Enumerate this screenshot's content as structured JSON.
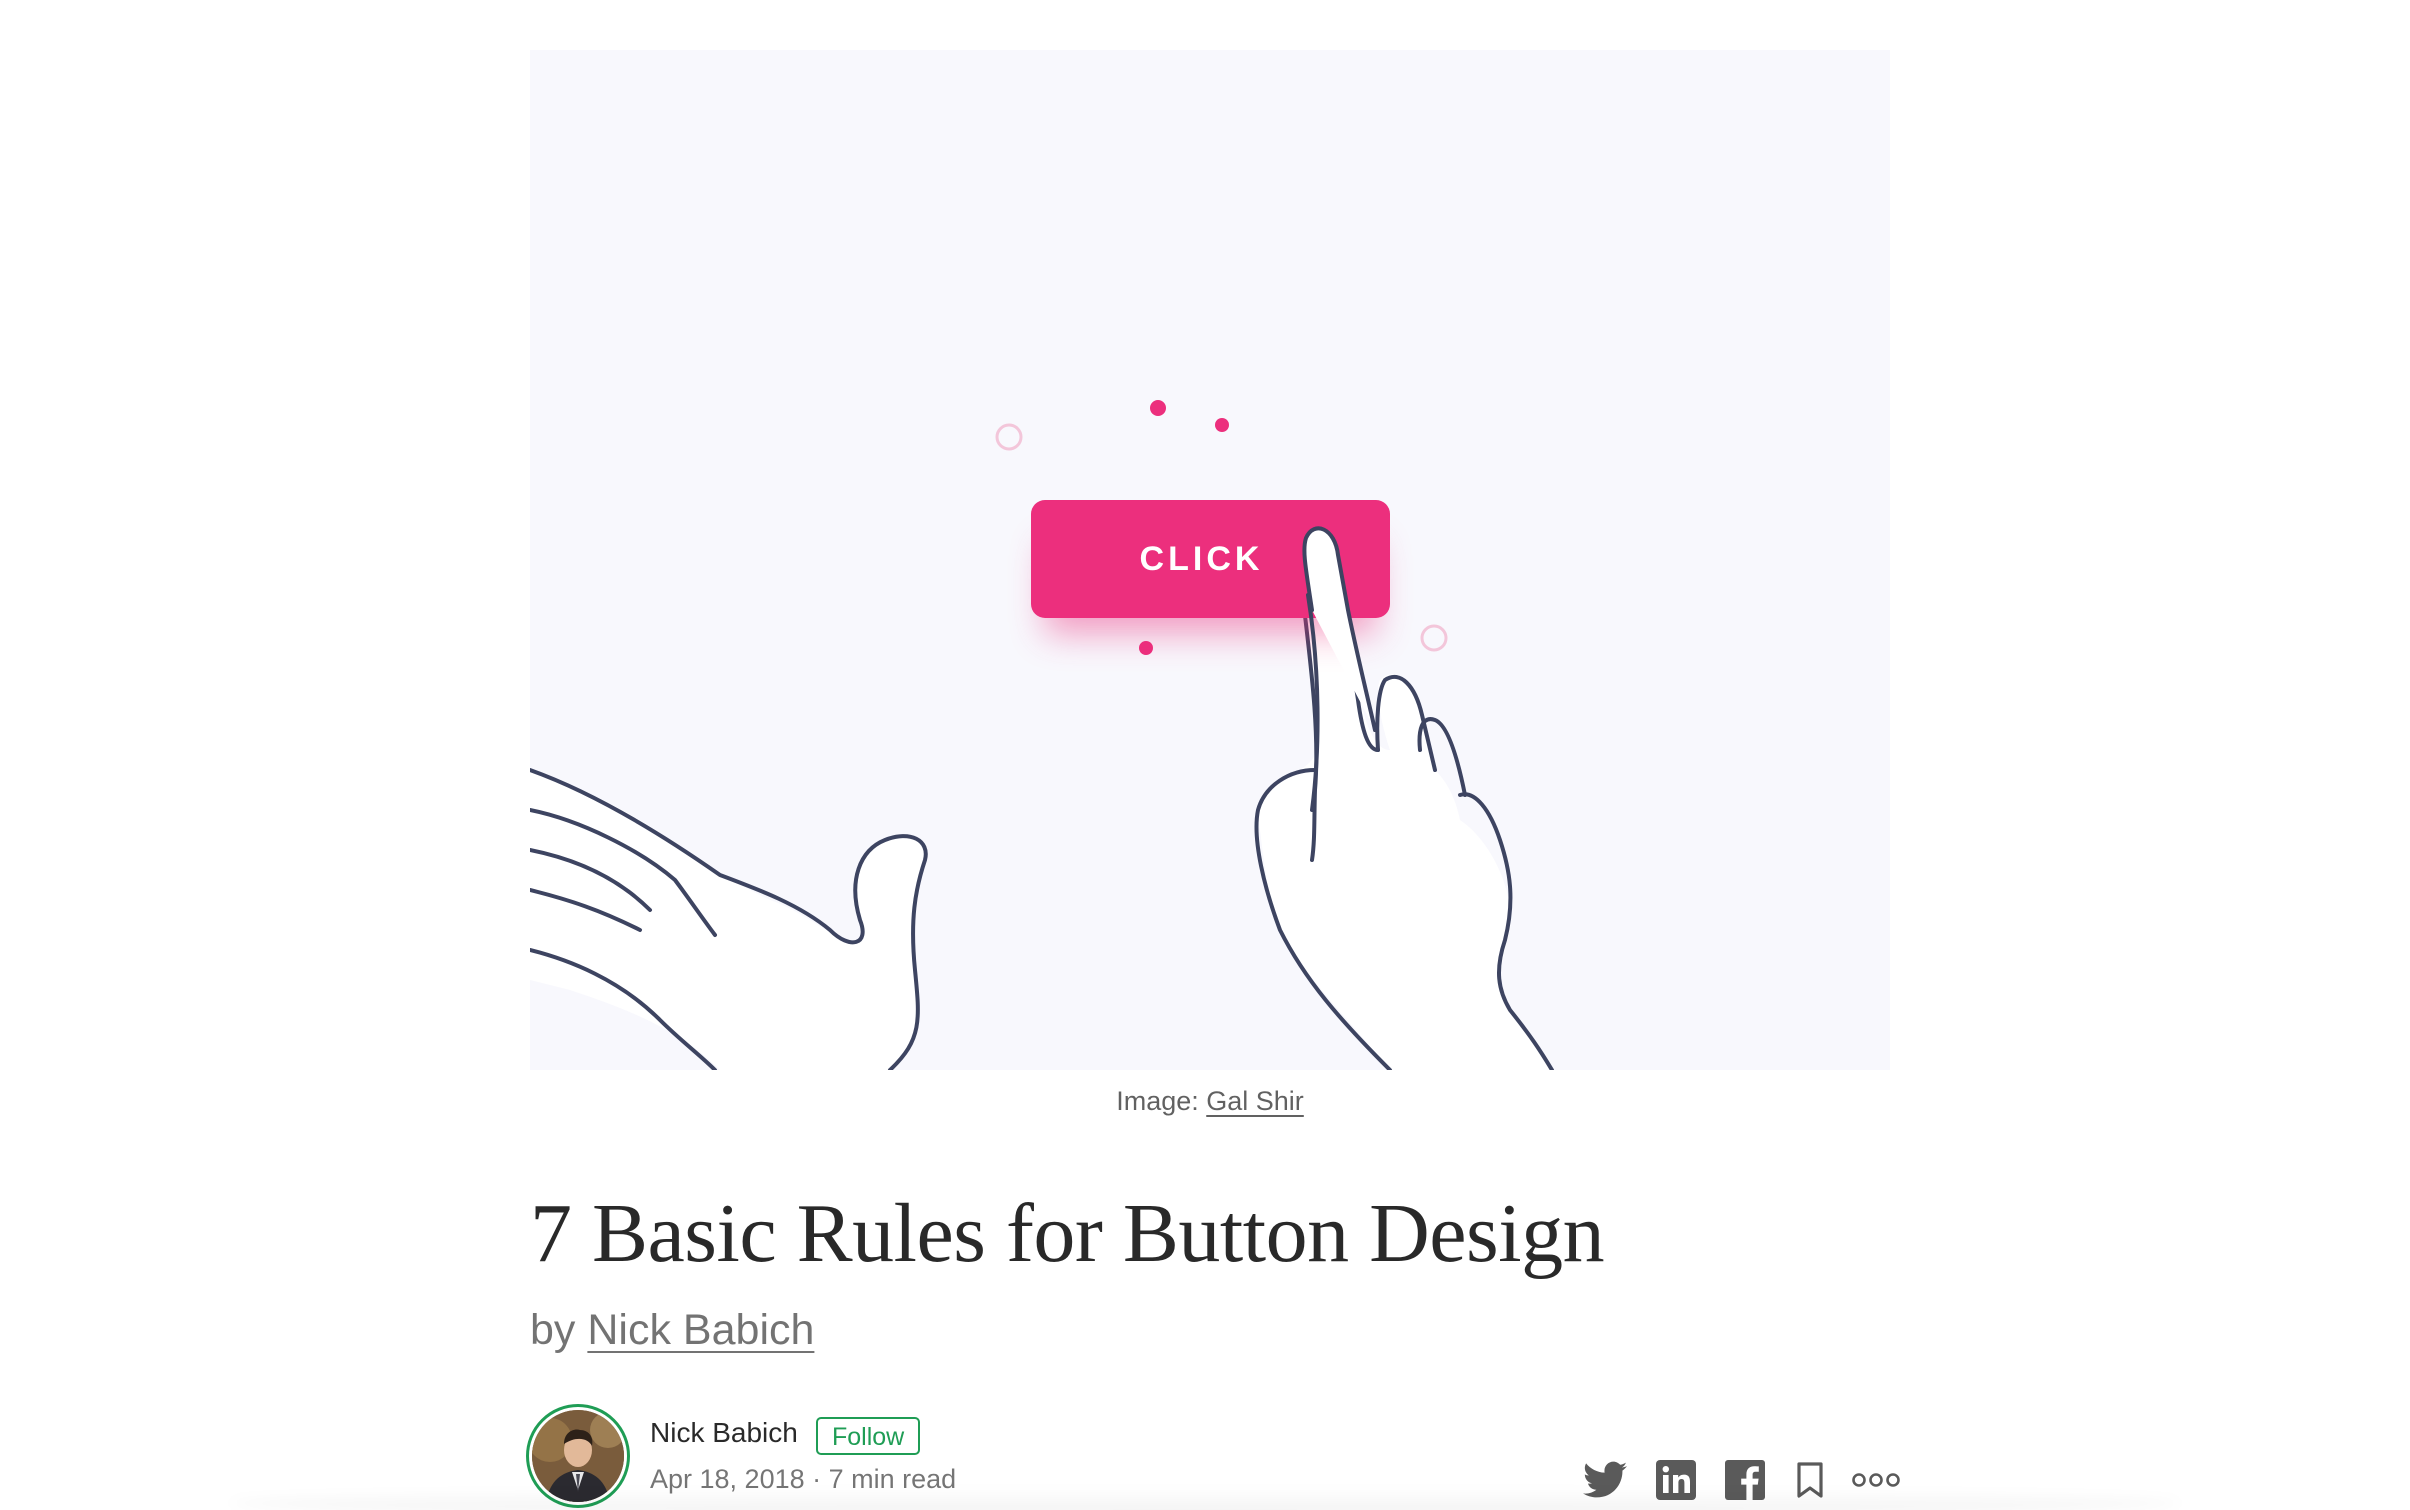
{
  "hero": {
    "button_label": "CLICK",
    "caption_prefix": "Image: ",
    "caption_link": "Gal Shir",
    "accent_color": "#ec2f7d",
    "background_color": "#f8f8fd"
  },
  "article": {
    "title": "7 Basic Rules for Button Design",
    "byline_prefix": "by ",
    "byline_author": "Nick Babich"
  },
  "author": {
    "name": "Nick Babich",
    "follow_label": "Follow",
    "date": "Apr 18, 2018",
    "separator": " · ",
    "read_time": "7 min read",
    "follow_color": "#1f9d55"
  },
  "share": {
    "icons": [
      "twitter-icon",
      "linkedin-icon",
      "facebook-icon",
      "bookmark-icon",
      "more-icon"
    ]
  }
}
